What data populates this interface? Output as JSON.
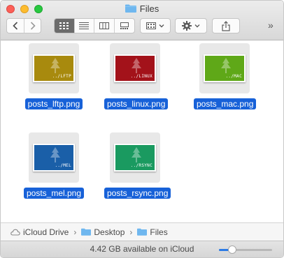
{
  "window": {
    "title": "Files"
  },
  "toolbar": {
    "back_icon": "chevron-left-icon",
    "forward_icon": "chevron-right-icon",
    "view_modes": [
      "icon-view",
      "list-view",
      "column-view",
      "gallery-view"
    ],
    "active_view": "icon-view",
    "arrange_icon": "group-grid-icon",
    "action_icon": "gear-icon",
    "share_icon": "share-icon",
    "overflow_label": "»"
  },
  "files": [
    {
      "name": "posts_lftp.png",
      "thumb_text": "../LFTP",
      "color": "#a88a0e"
    },
    {
      "name": "posts_linux.png",
      "thumb_text": "../LINUX",
      "color": "#a3121a"
    },
    {
      "name": "posts_mac.png",
      "thumb_text": "../MAC",
      "color": "#5fa818"
    },
    {
      "name": "posts_mel.png",
      "thumb_text": "../MEL",
      "color": "#1a5fa8"
    },
    {
      "name": "posts_rsync.png",
      "thumb_text": "../RSYNC",
      "color": "#1a9a60"
    }
  ],
  "pathbar": {
    "items": [
      {
        "label": "iCloud Drive",
        "icon": "cloud-icon"
      },
      {
        "label": "Desktop",
        "icon": "folder-icon"
      },
      {
        "label": "Files",
        "icon": "folder-icon"
      }
    ]
  },
  "statusbar": {
    "text": "4.42 GB available on iCloud",
    "zoom_level": 0.25
  },
  "colors": {
    "selection": "#1761d8",
    "folder": "#6fb7ef"
  }
}
